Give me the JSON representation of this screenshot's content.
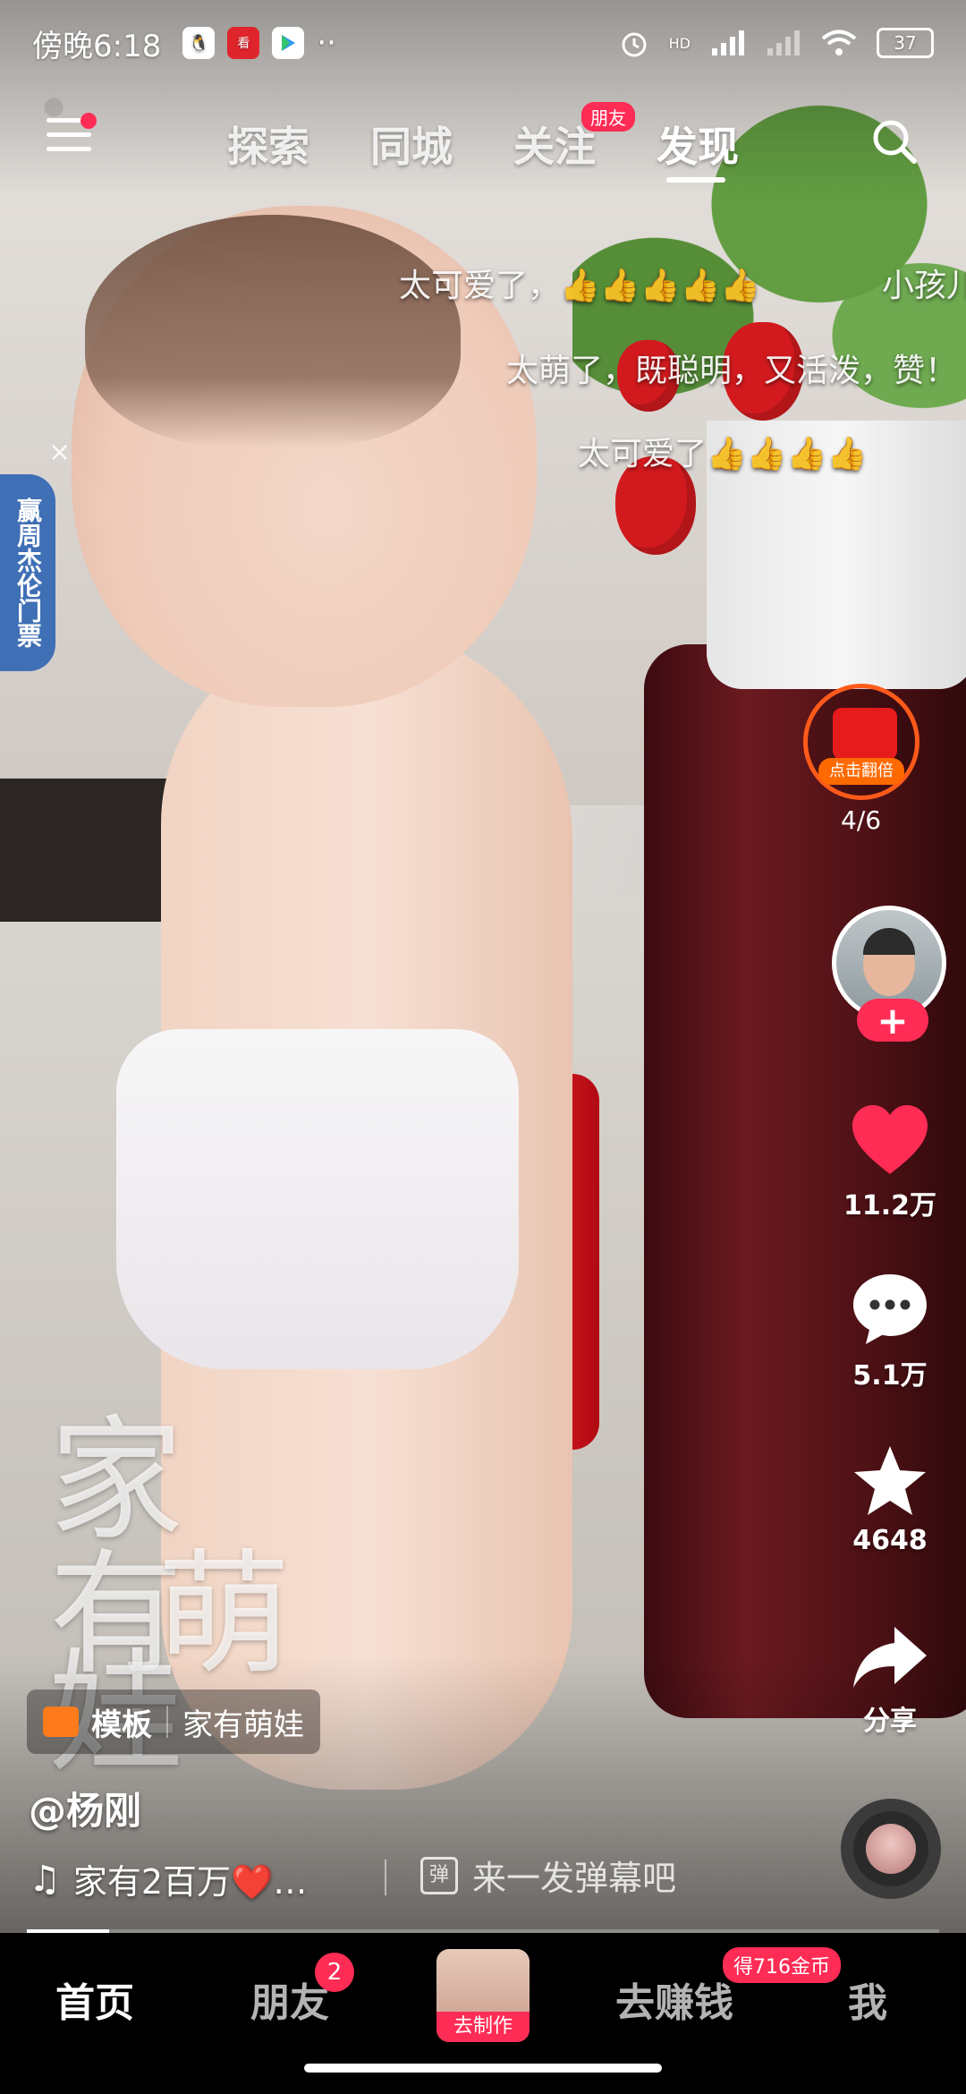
{
  "status_bar": {
    "time": "傍晚6:18",
    "apps": [
      "qq-icon",
      "news-app-icon",
      "play-store-icon"
    ],
    "more": "··",
    "signal_label": "HD",
    "battery": "37"
  },
  "top_nav": {
    "tabs": [
      {
        "label": "探索"
      },
      {
        "label": "同城"
      },
      {
        "label": "关注"
      },
      {
        "label": "发现"
      }
    ],
    "friend_badge": "朋友",
    "active_tab": "发现"
  },
  "danmaku": [
    {
      "text": "太可爱了，👍👍👍👍👍"
    },
    {
      "text": "小孩儿"
    },
    {
      "text": "太萌了，既聪明，又活泼，赞！"
    },
    {
      "text": "太可爱了👍👍👍👍"
    }
  ],
  "promo": {
    "text": "赢周杰伦门票",
    "close": "×"
  },
  "red_packet": {
    "label": "点击翻倍",
    "counter": "4/6"
  },
  "actions": {
    "follow": "+",
    "likes": "11.2万",
    "comments": "5.1万",
    "favorites": "4648",
    "share": "分享"
  },
  "video": {
    "watermark": [
      "家",
      "有",
      "萌",
      "娃"
    ],
    "template_label": "模板",
    "template_name": "家有萌娃",
    "author": "@杨刚",
    "music": "家有2百万❤️…",
    "danmu_placeholder": "来一发弹幕吧",
    "danmu_icon": "弹",
    "progress": 0.09
  },
  "bottom_nav": {
    "items": [
      {
        "label": "首页"
      },
      {
        "label": "朋友"
      },
      {
        "label": "去制作"
      },
      {
        "label": "去赚钱"
      },
      {
        "label": "我"
      }
    ],
    "friends_badge": "2",
    "coin_badge": "得716金币"
  },
  "colors": {
    "accent": "#ff2c55",
    "like": "#ff2c55",
    "promo": "#3f6fb5",
    "red_packet": "#e61b1b"
  }
}
